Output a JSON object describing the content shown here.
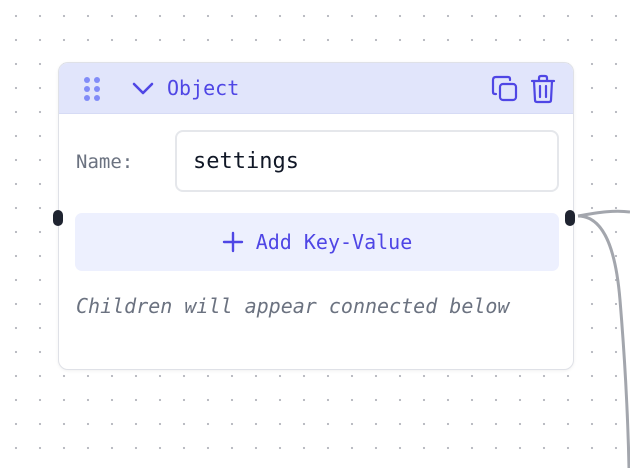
{
  "node": {
    "type_label": "Object",
    "name_label": "Name:",
    "name_value": "settings",
    "add_button_label": "Add Key-Value",
    "hint_text": "Children will appear connected below"
  },
  "icons": {
    "drag": "drag-handle-icon",
    "collapse": "chevron-down-icon",
    "copy": "copy-icon",
    "delete": "trash-icon",
    "add": "plus-icon"
  },
  "colors": {
    "accent": "#4f46e5",
    "header_bg": "#e1e5fb",
    "button_bg": "#edf0fe",
    "handle": "#1f2430",
    "edge": "#9ca3af"
  }
}
